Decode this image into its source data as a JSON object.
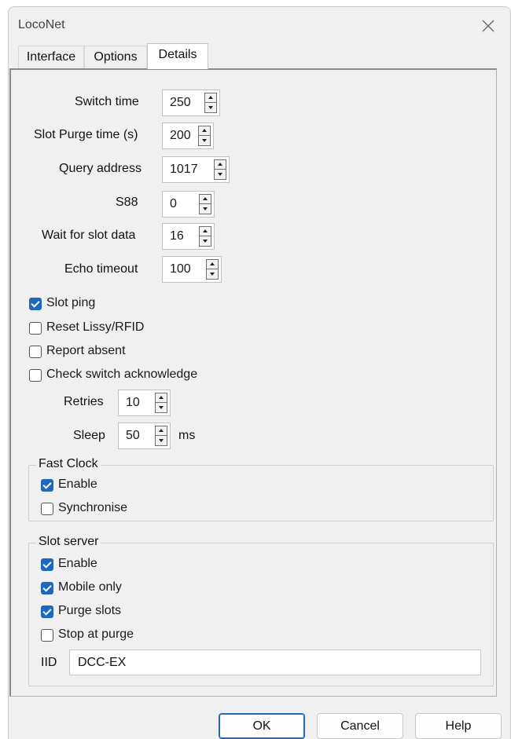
{
  "window": {
    "title": "LocoNet"
  },
  "tabs": [
    {
      "label": "Interface"
    },
    {
      "label": "Options"
    },
    {
      "label": "Details"
    }
  ],
  "details": {
    "spinners": [
      {
        "label": "Switch time",
        "value": "250"
      },
      {
        "label": "Slot Purge time (s)",
        "value": "200"
      },
      {
        "label": "Query address",
        "value": "1017"
      },
      {
        "label": "S88",
        "value": "0"
      },
      {
        "label": "Wait for slot data",
        "value": "16"
      },
      {
        "label": "Echo timeout",
        "value": "100"
      }
    ],
    "checks": [
      {
        "label": "Slot ping",
        "checked": true
      },
      {
        "label": "Reset Lissy/RFID",
        "checked": false
      },
      {
        "label": "Report absent",
        "checked": false
      },
      {
        "label": "Check switch acknowledge",
        "checked": false
      }
    ],
    "retries": {
      "label": "Retries",
      "value": "10"
    },
    "sleep": {
      "label": "Sleep",
      "value": "50",
      "unit": "ms"
    }
  },
  "fast_clock": {
    "title": "Fast Clock",
    "enable": {
      "label": "Enable",
      "checked": true
    },
    "synchronise": {
      "label": "Synchronise",
      "checked": false
    }
  },
  "slot_server": {
    "title": "Slot server",
    "enable": {
      "label": "Enable",
      "checked": true
    },
    "mobile_only": {
      "label": "Mobile only",
      "checked": true
    },
    "purge_slots": {
      "label": "Purge slots",
      "checked": true
    },
    "stop_at_purge": {
      "label": "Stop at purge",
      "checked": false
    },
    "iid": {
      "label": "IID",
      "value": "DCC-EX"
    }
  },
  "buttons": {
    "ok": "OK",
    "cancel": "Cancel",
    "help": "Help"
  },
  "colors": {
    "accent": "#1a68c7",
    "dialog_bg": "#f0f0f0"
  }
}
